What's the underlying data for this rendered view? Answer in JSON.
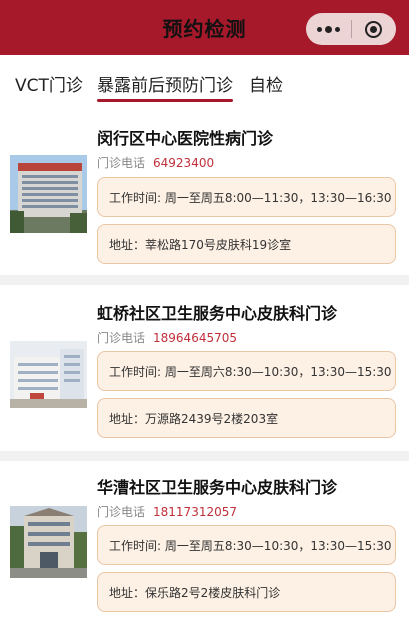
{
  "header": {
    "title": "预约检测"
  },
  "tabs": [
    {
      "label": "VCT门诊"
    },
    {
      "label": "暴露前后预防门诊"
    },
    {
      "label": "自检"
    }
  ],
  "clinics": [
    {
      "name": "闵行区中心医院性病门诊",
      "phone_label": "门诊电话",
      "phone": "64923400",
      "hours": "工作时间: 周一至周五8:00—11:30，13:30—16:30",
      "address": "地址：莘松路170号皮肤科19诊室"
    },
    {
      "name": "虹桥社区卫生服务中心皮肤科门诊",
      "phone_label": "门诊电话",
      "phone": "18964645705",
      "hours": "工作时间: 周一至周六8:30—10:30，13:30—15:30",
      "address": "地址：万源路2439号2楼203室"
    },
    {
      "name": "华漕社区卫生服务中心皮肤科门诊",
      "phone_label": "门诊电话",
      "phone": "18117312057",
      "hours": "工作时间: 周一至周五8:30—10:30，13:30—15:30",
      "address": "地址：保乐路2号2楼皮肤科门诊"
    }
  ],
  "colors": {
    "brand": "#a5192a",
    "phone": "#c0303a",
    "box_bg": "#fdf0e4",
    "box_border": "#e9c6a6"
  },
  "icons": [
    "more-dots-icon",
    "close-target-icon"
  ]
}
